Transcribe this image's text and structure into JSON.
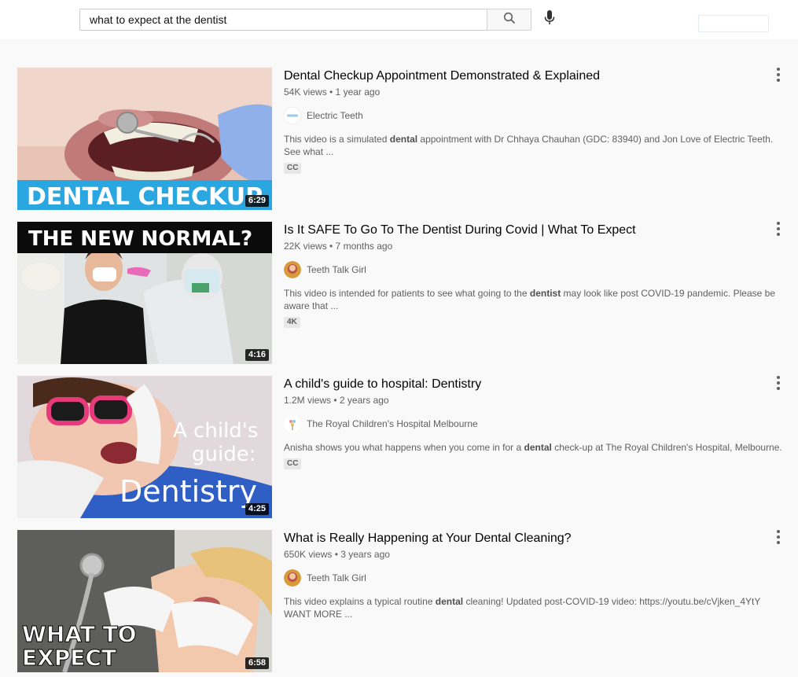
{
  "search": {
    "query": "what to expect at the dentist",
    "search_icon": "search-icon",
    "mic_icon": "microphone-icon"
  },
  "videos": [
    {
      "title": "Dental Checkup Appointment Demonstrated & Explained",
      "views": "54K views • 1 year ago",
      "channel": "Electric Teeth",
      "description_pre": "This video is a simulated ",
      "description_bold": "dental",
      "description_post": " appointment with Dr Chhaya Chauhan (GDC: 83940) and Jon Love of Electric Teeth. See what ...",
      "badge": "CC",
      "duration": "6:29",
      "thumb_caption": "DENTAL CHECKUP"
    },
    {
      "title": "Is It SAFE To Go To The Dentist During Covid | What To Expect",
      "views": "22K views • 7 months ago",
      "channel": "Teeth Talk Girl",
      "description_pre": "This video is intended for patients to see what going to the ",
      "description_bold": "dentist",
      "description_post": " may look like post COVID-19 pandemic. Please be aware that ...",
      "badge": "4K",
      "duration": "4:16",
      "thumb_caption": "THE NEW NORMAL?"
    },
    {
      "title": "A child's guide to hospital: Dentistry",
      "views": "1.2M views • 2 years ago",
      "channel": "The Royal Children's Hospital Melbourne",
      "description_pre": "Anisha shows you what happens when you come in for a ",
      "description_bold": "dental",
      "description_post": " check-up at The Royal Children's Hospital, Melbourne.",
      "badge": "CC",
      "duration": "4:25",
      "thumb_caption_1": "A child's",
      "thumb_caption_2": "guide:",
      "thumb_caption_3": "Dentistry"
    },
    {
      "title": "What is Really Happening at Your Dental Cleaning?",
      "views": "650K views • 3 years ago",
      "channel": "Teeth Talk Girl",
      "description_pre": "This video explains a typical routine ",
      "description_bold": "dental",
      "description_post": " cleaning! Updated post-COVID-19 video: https://youtu.be/cVjken_4YtY WANT MORE ...",
      "badge": "",
      "duration": "6:58",
      "thumb_caption_1": "WHAT TO",
      "thumb_caption_2": "EXPECT"
    }
  ],
  "colors": {
    "background": "#f9f9f9",
    "title": "#030303",
    "meta": "#606060",
    "accent_blue": "#2aa7e0"
  }
}
